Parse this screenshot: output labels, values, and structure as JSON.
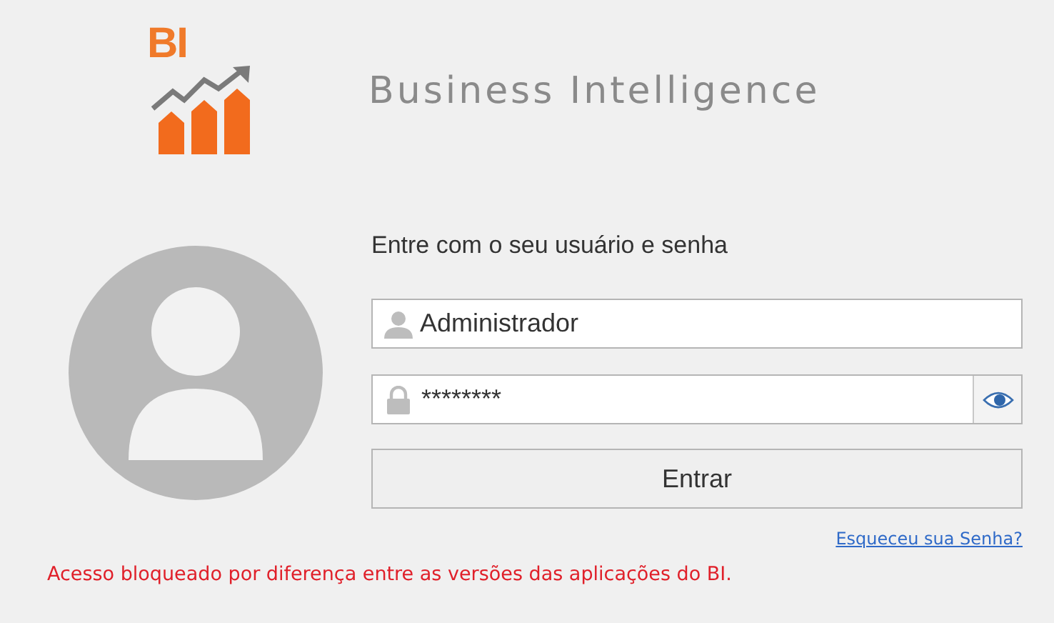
{
  "logo": {
    "text": "BI"
  },
  "title": "Business Intelligence",
  "prompt": "Entre com o seu usuário e senha",
  "username": {
    "value": "Administrador"
  },
  "password": {
    "value": "********",
    "revealed": false
  },
  "buttons": [
    "Entrar"
  ],
  "forgot_link": "Esqueceu sua Senha?",
  "error": "Acesso bloqueado por diferença entre as versões das aplicações do BI."
}
